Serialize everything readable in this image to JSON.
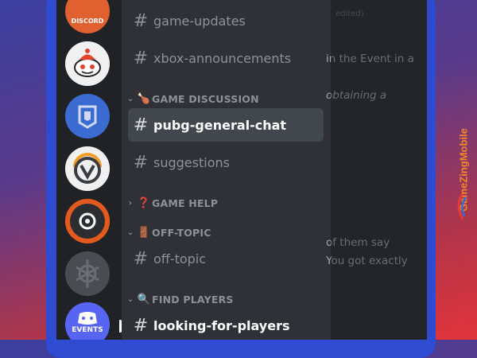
{
  "servers": [
    {
      "name": "discord-server",
      "label": "DISCORD",
      "color": "#e0612f"
    },
    {
      "name": "reddit-server",
      "color": "#f0f0f0"
    },
    {
      "name": "destiny-server",
      "color": "#3b6bd1"
    },
    {
      "name": "overwatch-server",
      "color": "#f0f0f0"
    },
    {
      "name": "steelseries-server",
      "color": "#e35a1e"
    },
    {
      "name": "knot-server",
      "color": "#4a4c52"
    },
    {
      "name": "events-server",
      "label": "EVENTS",
      "color": "#5865f2"
    }
  ],
  "channels": {
    "game_updates": "game-updates",
    "xbox_announcements": "xbox-announcements",
    "pubg_general_chat": "pubg-general-chat",
    "suggestions": "suggestions",
    "off_topic": "off-topic",
    "looking_for_players": "looking-for-players"
  },
  "hash_symbol": "#",
  "categories": {
    "game_discussion": {
      "label": "GAME DISCUSSION",
      "emoji": "🍗",
      "chevron": "⌄"
    },
    "game_help": {
      "label": "GAME HELP",
      "emoji": "❓",
      "chevron": "›"
    },
    "off_topic": {
      "label": "OFF-TOPIC",
      "emoji": "🚪",
      "chevron": "⌄"
    },
    "find_players": {
      "label": "FIND PLAYERS",
      "emoji": "🔍",
      "chevron": "⌄"
    }
  },
  "chat": {
    "edited": "edited)",
    "line1": "in the Event in a",
    "line2": "obtaining a",
    "line3": "of them say",
    "line4": "You got exactly"
  },
  "watermark": {
    "text": "GameZingMobile",
    "color": "#f08a2a"
  }
}
